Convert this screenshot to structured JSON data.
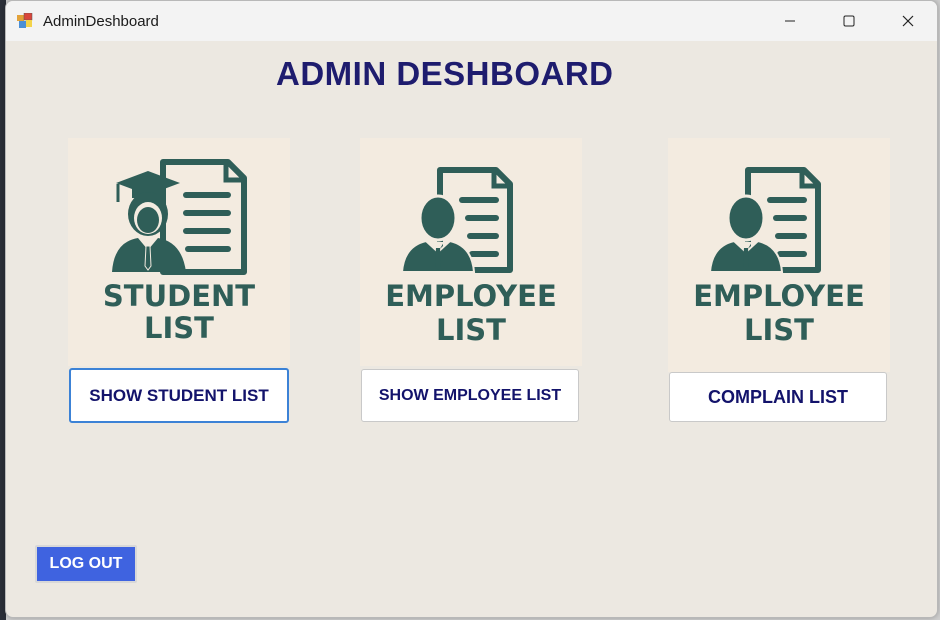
{
  "window": {
    "title": "AdminDeshboard"
  },
  "page": {
    "title": "ADMIN DESHBOARD"
  },
  "cards": [
    {
      "caption_line1": "STUDENT",
      "caption_line2": "LIST",
      "icon": "student-document-icon",
      "button": "SHOW STUDENT LIST"
    },
    {
      "caption_line1": "EMPLOYEE",
      "caption_line2": "LIST",
      "icon": "employee-document-icon",
      "button": "SHOW EMPLOYEE LIST"
    },
    {
      "caption_line1": "EMPLOYEE",
      "caption_line2": "LIST",
      "icon": "employee-document-icon",
      "button": "COMPLAIN LIST"
    }
  ],
  "logout": {
    "label": "LOG OUT"
  },
  "colors": {
    "title": "#1e1c6e",
    "icon": "#2f5e58",
    "logout_bg": "#3f63e0",
    "card_bg": "#f3ebe0"
  }
}
